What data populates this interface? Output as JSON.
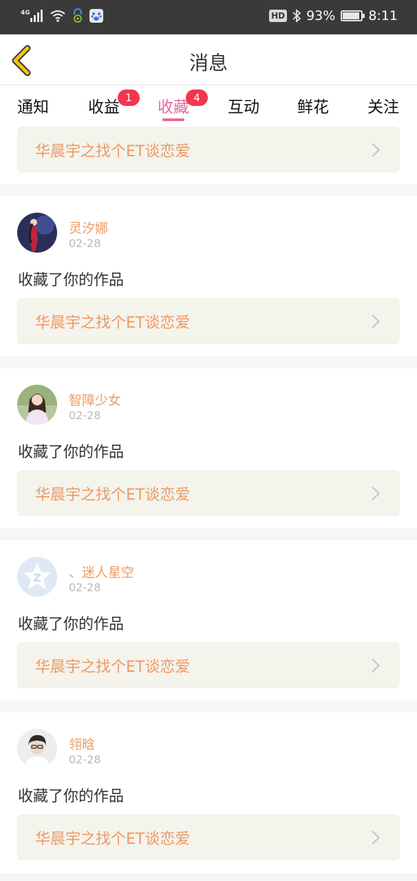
{
  "status_bar": {
    "network": "4G",
    "battery": "93%",
    "battery_level": 0.93,
    "time": "8:11",
    "hd": "HD"
  },
  "header": {
    "title": "消息"
  },
  "tabs": [
    {
      "label": "通知",
      "badge": ""
    },
    {
      "label": "收益",
      "badge": "1"
    },
    {
      "label": "收藏",
      "badge": "4"
    },
    {
      "label": "互动",
      "badge": ""
    },
    {
      "label": "鲜花",
      "badge": ""
    },
    {
      "label": "关注",
      "badge": ""
    }
  ],
  "top_item": {
    "work_title": "华晨宇之找个ET谈恋爱"
  },
  "items": [
    {
      "name": "灵汐娜",
      "date": "02-28",
      "action": "收藏了你的作品",
      "work_title": "华晨宇之找个ET谈恋爱"
    },
    {
      "name": "智障少女",
      "date": "02-28",
      "action": "收藏了你的作品",
      "work_title": "华晨宇之找个ET谈恋爱"
    },
    {
      "name": "、迷人星空",
      "date": "02-28",
      "action": "收藏了你的作品",
      "work_title": "华晨宇之找个ET谈恋爱"
    },
    {
      "name": "翎晗",
      "date": "02-28",
      "action": "收藏了你的作品",
      "work_title": "华晨宇之找个ET谈恋爱"
    }
  ],
  "colors": {
    "accent": "#e56aa1",
    "name_color": "#ed9a62",
    "badge": "#f0374f",
    "back_arrow": "#f2c511"
  }
}
